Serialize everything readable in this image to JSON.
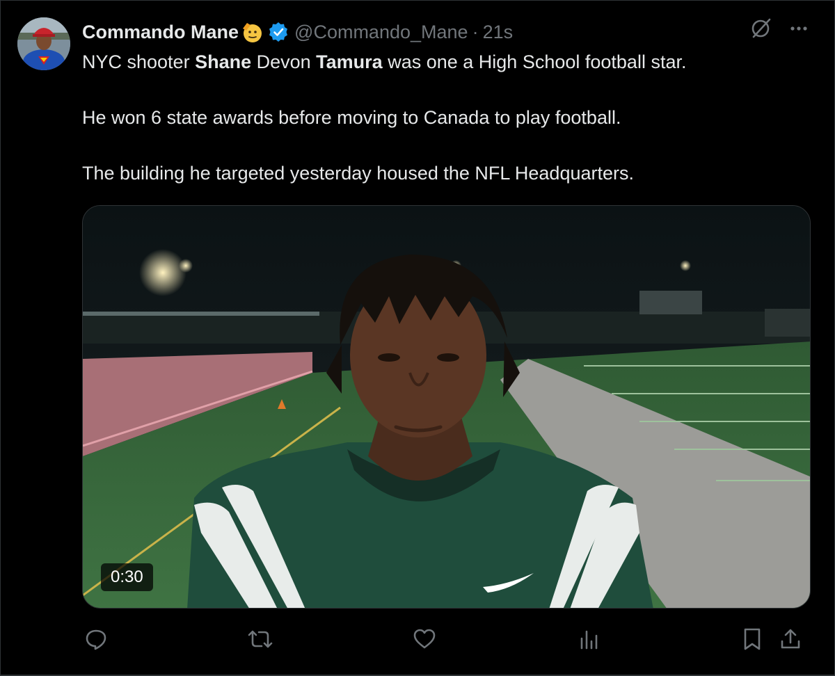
{
  "post": {
    "display_name": "Commando Mane",
    "handle": "@Commando_Mane",
    "separator": "·",
    "time": "21s",
    "text": {
      "line1_part1": "NYC shooter ",
      "line1_bold1": "Shane",
      "line1_part2": " Devon ",
      "line1_bold2": "Tamura",
      "line1_part3": " was one a High School football star.",
      "paragraph2": "He won 6 state awards before moving to Canada to play football.",
      "paragraph3": "The building he targeted yesterday housed the NFL Headquarters."
    },
    "video": {
      "duration": "0:30"
    }
  },
  "icons": {
    "emoji": "saluting-face-icon",
    "verified": "verified-badge-icon",
    "grok": "grok-icon",
    "more": "more-icon",
    "reply": "reply-icon",
    "repost": "repost-icon",
    "like": "like-icon",
    "views": "views-icon",
    "bookmark": "bookmark-icon",
    "share": "share-icon"
  },
  "colors": {
    "background": "#000000",
    "text": "#e7e9ea",
    "secondary": "#71767b",
    "verified": "#1d9bf0",
    "jersey": "#1f4d3c",
    "field": "#3c6b3e",
    "track": "#b07a80"
  }
}
